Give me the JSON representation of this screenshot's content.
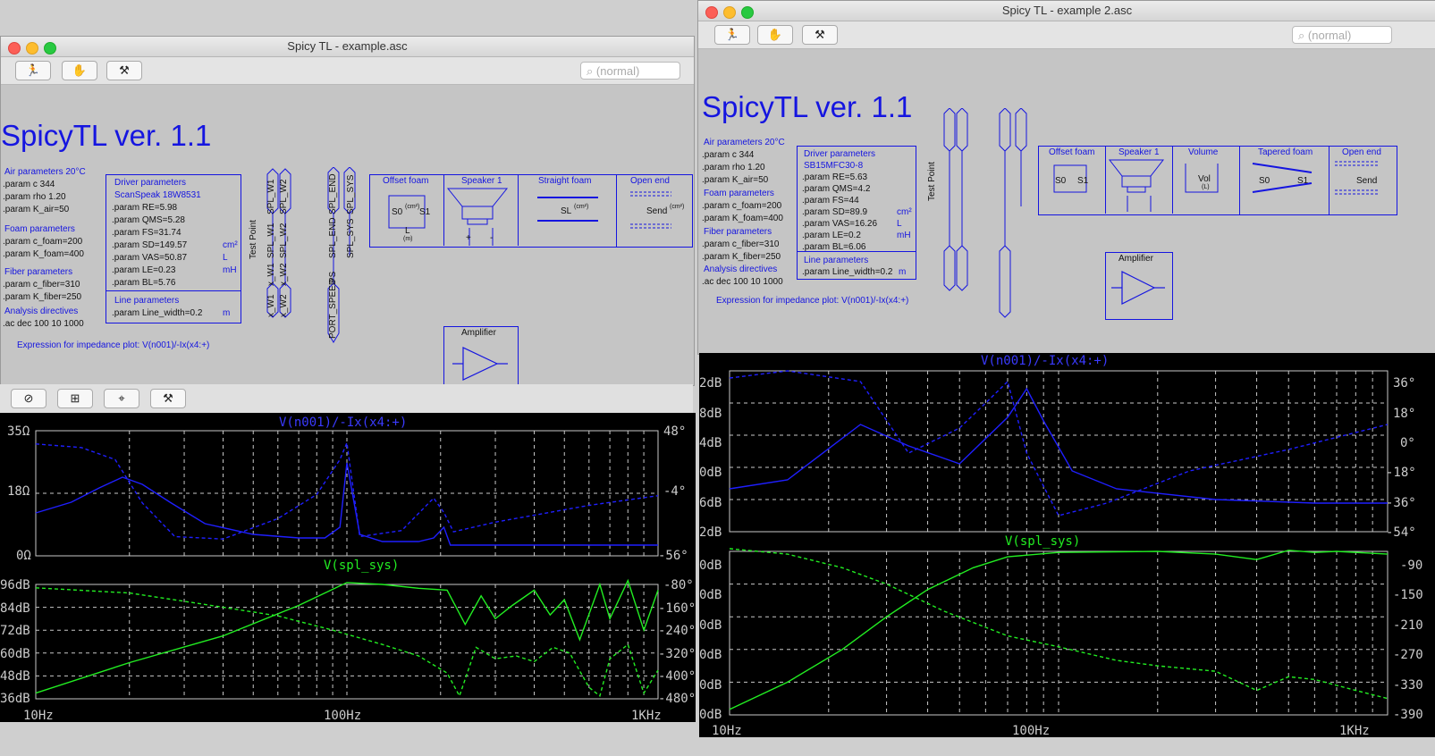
{
  "win1": {
    "title": "Spicy TL - example.asc",
    "search_placeholder": "(normal)",
    "app_title": "SpicyTL ver. 1.1",
    "air_header": "Air parameters 20°C",
    "air_lines": [
      ".param c 344",
      ".param rho 1.20",
      ".param K_air=50"
    ],
    "foam_header": "Foam parameters",
    "foam_lines": [
      ".param c_foam=200",
      ".param K_foam=400"
    ],
    "fiber_header": "Fiber parameters",
    "fiber_lines": [
      ".param c_fiber=310",
      ".param K_fiber=250"
    ],
    "analysis_header": "Analysis directives",
    "analysis_line": ".ac dec 100 10 1000",
    "driver_header": "Driver parameters",
    "driver_name": "ScanSpeak 18W8531",
    "driver_lines": [
      ".param RE=5.98",
      ".param QMS=5.28",
      ".param FS=31.74",
      ".param SD=149.57",
      ".param VAS=50.87",
      ".param LE=0.23",
      ".param BL=5.76"
    ],
    "unit_cm2": "cm²",
    "unit_L": "L",
    "unit_mH": "mH",
    "line_header": "Line parameters",
    "line_width": ".param Line_width=0.2",
    "unit_m": "m",
    "impedance_expr": "Expression for impedance plot: V(n001)/-Ix(x4:+)",
    "test_point": "Test Point",
    "labels_top": [
      "SPL_W1",
      "SPL_W2",
      "SPL_END",
      "SPL_SYS"
    ],
    "labels_mid": [
      "SPL_W1",
      "SPL_W2",
      "SPL_END",
      "SPL_SYS"
    ],
    "labels_low": [
      "x_W1",
      "x_W2",
      "PS"
    ],
    "labels_bottom": [
      "x_W1",
      "x_W2",
      "PORT_SPEED"
    ],
    "blocks": [
      "Offset foam",
      "Speaker 1",
      "Straight foam",
      "Open end"
    ],
    "offset_s0": "S0",
    "offset_s1": "S1",
    "unit_cm2_paren": "(cm²)",
    "L": "L",
    "unit_m_paren": "(m)",
    "straight_sl": "SL",
    "send": "Send",
    "plus": "+",
    "minus": "-",
    "amplifier": "Amplifier"
  },
  "win2": {
    "title": "Spicy TL - example 2.asc",
    "search_placeholder": "(normal)",
    "app_title": "SpicyTL ver. 1.1",
    "air_header": "Air parameters 20°C",
    "air_lines": [
      ".param c 344",
      ".param rho 1.20",
      ".param K_air=50"
    ],
    "foam_header": "Foam parameters",
    "foam_lines": [
      ".param c_foam=200",
      ".param K_foam=400"
    ],
    "fiber_header": "Fiber parameters",
    "fiber_lines": [
      ".param c_fiber=310",
      ".param K_fiber=250"
    ],
    "analysis_header": "Analysis directives",
    "analysis_line": ".ac dec 100 10 1000",
    "driver_header": "Driver parameters",
    "driver_name": "SB15MFC30-8",
    "driver_lines": [
      ".param RE=5.63",
      ".param QMS=4.2",
      ".param FS=44",
      ".param SD=89.9",
      ".param VAS=16.26",
      ".param LE=0.2",
      ".param BL=6.06"
    ],
    "unit_cm2": "cm²",
    "unit_L": "L",
    "unit_mH": "mH",
    "line_header": "Line parameters",
    "line_width": ".param Line_width=0.2",
    "unit_m": "m",
    "impedance_expr": "Expression for impedance plot: V(n001)/-Ix(x4:+)",
    "test_point": "Test Point",
    "blocks": [
      "Offset foam",
      "Speaker 1",
      "Volume",
      "Tapered foam",
      "Open end"
    ],
    "vol": "Vol",
    "vol_unit": "(L)",
    "send": "Send",
    "s0": "S0",
    "s1": "S1",
    "amplifier": "Amplifier"
  },
  "colors": {
    "trace_blue": "#1f1fff",
    "trace_green": "#22ee22",
    "schematic_blue": "#1515e0",
    "grid": "#c8c8c8"
  },
  "chart_data": [
    {
      "type": "line",
      "title": "V(n001)/-Ix(x4:+)",
      "x_scale": "log",
      "x_ticks": [
        "10Hz",
        "100Hz",
        "1KHz"
      ],
      "y_ticks": [
        "35Ω",
        "18Ω",
        "0Ω"
      ],
      "y2_ticks": [
        "48°",
        "-4°",
        "-56°"
      ],
      "ylim": [
        0,
        35
      ],
      "y2lim": [
        -56,
        48
      ],
      "series": [
        {
          "style": "solid",
          "axis": "left",
          "x": [
            10,
            13,
            16,
            19,
            22,
            27,
            35,
            50,
            70,
            85,
            95,
            100,
            110,
            130,
            170,
            190,
            205,
            215,
            250,
            400,
            1000
          ],
          "y": [
            12,
            15,
            19,
            22,
            20,
            15,
            9,
            6,
            5,
            5,
            8,
            26,
            6,
            4,
            4,
            5,
            8,
            3,
            3,
            3,
            3
          ]
        },
        {
          "style": "dashed",
          "axis": "right",
          "x": [
            10,
            14,
            18,
            22,
            28,
            40,
            60,
            80,
            95,
            100,
            110,
            150,
            190,
            205,
            220,
            300,
            600,
            1000
          ],
          "y": [
            37,
            34,
            24,
            -12,
            -40,
            -42,
            -25,
            -5,
            24,
            38,
            -40,
            -35,
            -8,
            -20,
            -36,
            -28,
            -14,
            -6
          ]
        }
      ]
    },
    {
      "type": "line",
      "title": "V(spl_sys)",
      "x_scale": "log",
      "x_ticks": [
        "10Hz",
        "100Hz",
        "1KHz"
      ],
      "y_ticks": [
        "96dB",
        "84dB",
        "72dB",
        "60dB",
        "48dB",
        "36dB"
      ],
      "y2_ticks": [
        "-80°",
        "-160°",
        "-240°",
        "-320°",
        "-400°",
        "-480°"
      ],
      "ylim": [
        36,
        96
      ],
      "y2lim": [
        -480,
        -80
      ],
      "series": [
        {
          "style": "solid",
          "axis": "left",
          "x": [
            10,
            20,
            40,
            70,
            100,
            130,
            170,
            210,
            240,
            270,
            300,
            340,
            400,
            450,
            500,
            560,
            650,
            700,
            800,
            900,
            1000
          ],
          "y": [
            39,
            55,
            69,
            85,
            97,
            96,
            94,
            93,
            75,
            90,
            78,
            85,
            93,
            80,
            88,
            67,
            96,
            78,
            98,
            72,
            93
          ]
        },
        {
          "style": "dashed",
          "axis": "right",
          "x": [
            10,
            20,
            35,
            60,
            90,
            130,
            170,
            210,
            230,
            260,
            300,
            350,
            400,
            460,
            520,
            600,
            650,
            700,
            800,
            900,
            1000
          ],
          "y": [
            -92,
            -110,
            -150,
            -190,
            -240,
            -290,
            -330,
            -390,
            -470,
            -300,
            -340,
            -330,
            -350,
            -300,
            -320,
            -440,
            -470,
            -340,
            -290,
            -460,
            -380
          ]
        }
      ]
    },
    {
      "type": "line",
      "title": "V(n001)/-Ix(x4:+)",
      "x_scale": "log",
      "x_ticks": [
        "10Hz",
        "100Hz",
        "1KHz"
      ],
      "y_ticks": [
        "2dB",
        "8dB",
        "4dB",
        "0dB",
        "6dB",
        "2dB"
      ],
      "y2_ticks": [
        "36°",
        "18°",
        "0°",
        "-18°",
        "-36°",
        "-54°"
      ],
      "y2lim": [
        -54,
        36
      ],
      "series": [
        {
          "style": "solid",
          "axis": "right",
          "x": [
            10,
            15,
            25,
            35,
            50,
            70,
            80,
            90,
            110,
            150,
            300,
            600,
            1000
          ],
          "y": [
            -30,
            -25,
            6,
            -6,
            -16,
            10,
            26,
            8,
            -20,
            -30,
            -36,
            -38,
            -38
          ]
        },
        {
          "style": "dashed",
          "axis": "right",
          "x": [
            10,
            15,
            25,
            35,
            50,
            60,
            70,
            80,
            100,
            140,
            250,
            500,
            1000
          ],
          "y": [
            32,
            36,
            30,
            -10,
            4,
            18,
            30,
            -10,
            -45,
            -38,
            -20,
            -8,
            6
          ]
        }
      ]
    },
    {
      "type": "line",
      "title": "V(spl_sys)",
      "x_scale": "log",
      "x_ticks": [
        "10Hz",
        "100Hz",
        "1KHz"
      ],
      "y_ticks": [
        "0dB",
        "0dB",
        "0dB",
        "0dB",
        "0dB",
        "0dB"
      ],
      "y2_ticks": [
        "-90",
        "-150",
        "-210",
        "-270",
        "-330",
        "-390"
      ],
      "y2lim": [
        -390,
        -90
      ],
      "series": [
        {
          "style": "solid",
          "axis": "right",
          "x": [
            10,
            15,
            22,
            30,
            40,
            55,
            70,
            100,
            200,
            300,
            400,
            500,
            600,
            700,
            1000
          ],
          "y": [
            -380,
            -330,
            -270,
            -210,
            -160,
            -120,
            -100,
            -92,
            -90,
            -95,
            -105,
            -88,
            -92,
            -90,
            -95
          ]
        },
        {
          "style": "dashed",
          "axis": "right",
          "x": [
            10,
            15,
            22,
            30,
            45,
            70,
            100,
            150,
            200,
            300,
            400,
            500,
            600,
            800,
            1000
          ],
          "y": [
            -85,
            -95,
            -120,
            -150,
            -200,
            -245,
            -265,
            -290,
            -300,
            -310,
            -345,
            -320,
            -325,
            -345,
            -360
          ]
        }
      ]
    }
  ]
}
